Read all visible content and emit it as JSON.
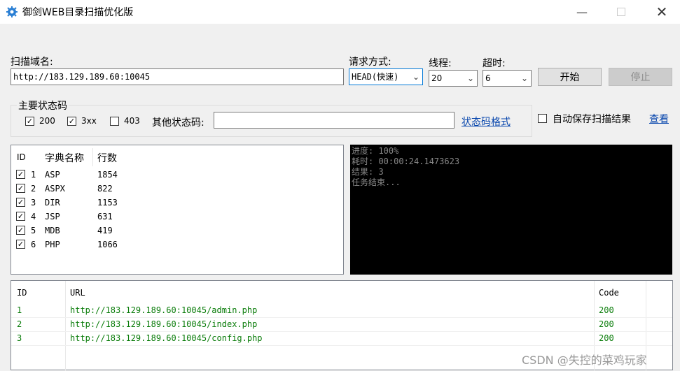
{
  "app": {
    "title": "御剑WEB目录扫描优化版"
  },
  "form": {
    "domain_label": "扫描域名:",
    "domain_value": "http://183.129.189.60:10045",
    "method_label": "请求方式:",
    "method_value": "HEAD(快速)",
    "threads_label": "线程:",
    "threads_value": "20",
    "timeout_label": "超时:",
    "timeout_value": "6",
    "start_label": "开始",
    "stop_label": "停止"
  },
  "status": {
    "group_label": "主要状态码",
    "codes": [
      {
        "label": "200",
        "checked": true
      },
      {
        "label": "3xx",
        "checked": true
      },
      {
        "label": "403",
        "checked": false
      }
    ],
    "other_label": "其他状态码:",
    "other_value": "",
    "format_link": "状态码格式",
    "autosave_label": "自动保存扫描结果",
    "view_link": "查看"
  },
  "dict": {
    "headers": [
      "ID",
      "字典名称",
      "行数"
    ],
    "rows": [
      {
        "id": "1",
        "name": "ASP",
        "lines": "1854",
        "checked": true
      },
      {
        "id": "2",
        "name": "ASPX",
        "lines": "822",
        "checked": true
      },
      {
        "id": "3",
        "name": "DIR",
        "lines": "1153",
        "checked": true
      },
      {
        "id": "4",
        "name": "JSP",
        "lines": "631",
        "checked": true
      },
      {
        "id": "5",
        "name": "MDB",
        "lines": "419",
        "checked": true
      },
      {
        "id": "6",
        "name": "PHP",
        "lines": "1066",
        "checked": true
      }
    ]
  },
  "console": {
    "lines": [
      "进度: 100%",
      "耗时: 00:00:24.1473623",
      "结果: 3",
      "任务结束..."
    ]
  },
  "results": {
    "headers": [
      "ID",
      "URL",
      "Code"
    ],
    "rows": [
      {
        "id": "1",
        "url": "http://183.129.189.60:10045/admin.php",
        "code": "200"
      },
      {
        "id": "2",
        "url": "http://183.129.189.60:10045/index.php",
        "code": "200"
      },
      {
        "id": "3",
        "url": "http://183.129.189.60:10045/config.php",
        "code": "200"
      }
    ]
  },
  "watermark": "CSDN @失控的菜鸡玩家"
}
